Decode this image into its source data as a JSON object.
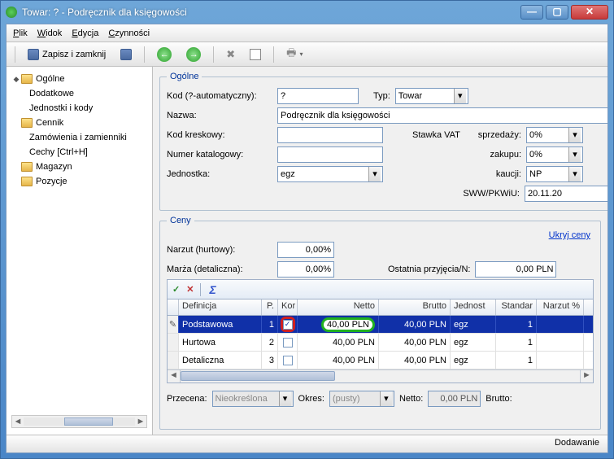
{
  "window": {
    "title": "Towar: ? - Podręcznik dla księgowości"
  },
  "menu": {
    "plik": "Plik",
    "widok": "Widok",
    "edycja": "Edycja",
    "czynnosci": "Czynności"
  },
  "toolbar": {
    "save_close": "Zapisz i zamknij"
  },
  "tree": {
    "ogolne": "Ogólne",
    "dodatkowe": "Dodatkowe",
    "jednostki": "Jednostki i kody",
    "cennik": "Cennik",
    "zamowienia": "Zamówienia i zamienniki",
    "cechy": "Cechy [Ctrl+H]",
    "magazyn": "Magazyn",
    "pozycje": "Pozycje"
  },
  "ogolne": {
    "legend": "Ogólne",
    "kod_label": "Kod (?-automatyczny):",
    "kod_value": "?",
    "typ_label": "Typ:",
    "typ_value": "Towar",
    "nazwa_label": "Nazwa:",
    "nazwa_value": "Podręcznik dla księgowości",
    "kreskowy_label": "Kod kreskowy:",
    "kreskowy_value": "",
    "vat_label": "Stawka VAT",
    "vat_sprz_label": "sprzedaży:",
    "vat_sprz_value": "0%",
    "katalog_label": "Numer katalogowy:",
    "katalog_value": "",
    "vat_zak_label": "zakupu:",
    "vat_zak_value": "0%",
    "jednostka_label": "Jednostka:",
    "jednostka_value": "egz",
    "kaucji_label": "kaucji:",
    "kaucji_value": "NP",
    "sww_label": "SWW/PKWiU:",
    "sww_value": "20.11.20"
  },
  "ceny": {
    "legend": "Ceny",
    "ukryj": "Ukryj ceny",
    "narzut_label": "Narzut (hurtowy):",
    "narzut_value": "0,00%",
    "marza_label": "Marża (detaliczna):",
    "marza_value": "0,00%",
    "ostatnia_label": "Ostatnia przyjęcia/N:",
    "ostatnia_value": "0,00 PLN",
    "columns": {
      "def": "Definicja",
      "pz": "P.",
      "kor": "Kor",
      "net": "Netto",
      "bru": "Brutto",
      "jed": "Jednost",
      "std": "Standar",
      "nar": "Narzut %"
    },
    "rows": [
      {
        "def": "Podstawowa",
        "pz": "1",
        "kor": true,
        "net": "40,00 PLN",
        "bru": "40,00 PLN",
        "jed": "egz",
        "std": "1",
        "nar": ""
      },
      {
        "def": "Hurtowa",
        "pz": "2",
        "kor": false,
        "net": "40,00 PLN",
        "bru": "40,00 PLN",
        "jed": "egz",
        "std": "1",
        "nar": ""
      },
      {
        "def": "Detaliczna",
        "pz": "3",
        "kor": false,
        "net": "40,00 PLN",
        "bru": "40,00 PLN",
        "jed": "egz",
        "std": "1",
        "nar": ""
      }
    ],
    "przecena_label": "Przecena:",
    "przecena_value": "Nieokreślona",
    "okres_label": "Okres:",
    "okres_value": "(pusty)",
    "netto_label": "Netto:",
    "netto_value": "0,00 PLN",
    "brutto_label": "Brutto:"
  },
  "status": {
    "text": "Dodawanie"
  }
}
